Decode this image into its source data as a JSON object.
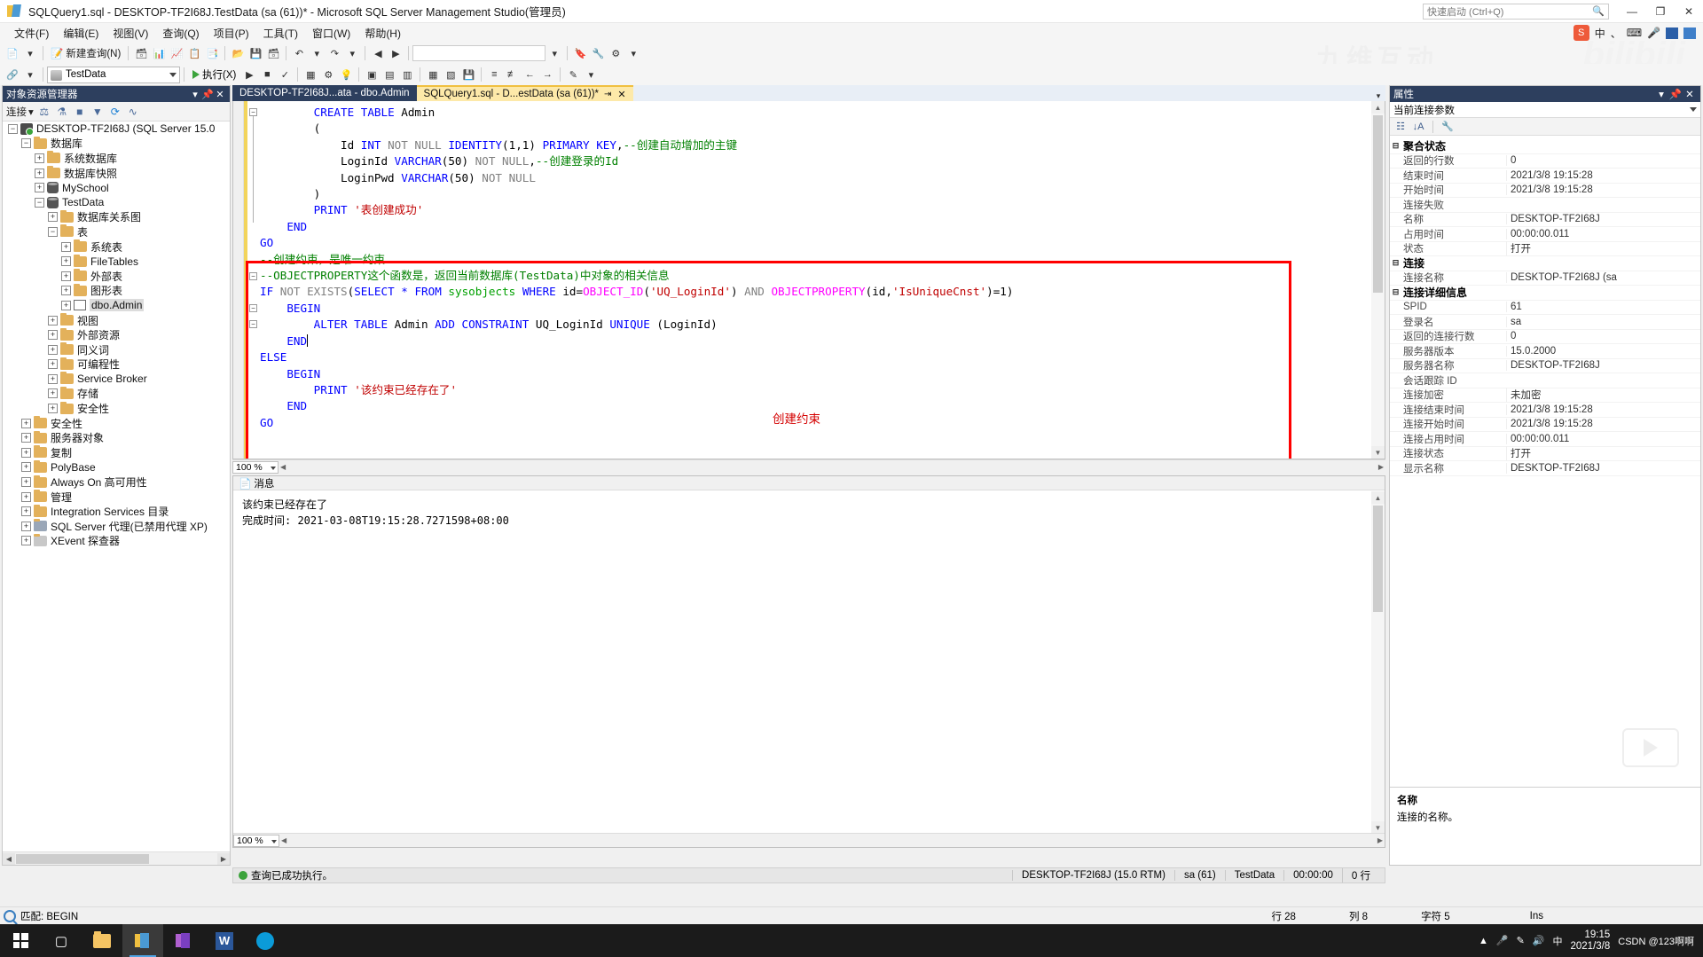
{
  "window": {
    "title": "SQLQuery1.sql - DESKTOP-TF2I68J.TestData (sa (61))* - Microsoft SQL Server Management Studio(管理员)",
    "quick_launch_placeholder": "快速启动 (Ctrl+Q)",
    "minimize": "—",
    "maximize": "❐",
    "close": "✕"
  },
  "menu": {
    "items": [
      "文件(F)",
      "编辑(E)",
      "视图(V)",
      "查询(Q)",
      "项目(P)",
      "工具(T)",
      "窗口(W)",
      "帮助(H)"
    ],
    "ime": {
      "badge": "S",
      "lang": "中",
      "dot": "、",
      "extra": "…"
    }
  },
  "toolbar1": {
    "new_query": "新建查询(N)",
    "database_label": "TestData",
    "items": [
      "文件",
      "打开",
      "保存",
      "全部保存",
      "撤消",
      "恢复"
    ]
  },
  "toolbar2": {
    "db_combo_value": "TestData",
    "execute": "执行(X)",
    "zoom": "100 %"
  },
  "object_explorer": {
    "title": "对象资源管理器",
    "connect_label": "连接",
    "tools": [
      "connect-icon",
      "disconnect-icon",
      "stop-icon",
      "filter-icon",
      "refresh-icon",
      "activity-icon"
    ],
    "tree": [
      {
        "indent": 0,
        "expander": "−",
        "icon": "server",
        "label": "DESKTOP-TF2I68J (SQL Server 15.0"
      },
      {
        "indent": 1,
        "expander": "−",
        "icon": "folder",
        "label": "数据库"
      },
      {
        "indent": 2,
        "expander": "+",
        "icon": "folder",
        "label": "系统数据库"
      },
      {
        "indent": 2,
        "expander": "+",
        "icon": "folder",
        "label": "数据库快照"
      },
      {
        "indent": 2,
        "expander": "+",
        "icon": "db",
        "label": "MySchool"
      },
      {
        "indent": 2,
        "expander": "−",
        "icon": "db",
        "label": "TestData"
      },
      {
        "indent": 3,
        "expander": "+",
        "icon": "folder",
        "label": "数据库关系图"
      },
      {
        "indent": 3,
        "expander": "−",
        "icon": "folder",
        "label": "表"
      },
      {
        "indent": 4,
        "expander": "+",
        "icon": "folder",
        "label": "系统表"
      },
      {
        "indent": 4,
        "expander": "+",
        "icon": "folder",
        "label": "FileTables"
      },
      {
        "indent": 4,
        "expander": "+",
        "icon": "folder",
        "label": "外部表"
      },
      {
        "indent": 4,
        "expander": "+",
        "icon": "folder",
        "label": "图形表"
      },
      {
        "indent": 4,
        "expander": "+",
        "icon": "table",
        "label": "dbo.Admin",
        "selected": true
      },
      {
        "indent": 3,
        "expander": "+",
        "icon": "folder",
        "label": "视图"
      },
      {
        "indent": 3,
        "expander": "+",
        "icon": "folder",
        "label": "外部资源"
      },
      {
        "indent": 3,
        "expander": "+",
        "icon": "folder",
        "label": "同义词"
      },
      {
        "indent": 3,
        "expander": "+",
        "icon": "folder",
        "label": "可编程性"
      },
      {
        "indent": 3,
        "expander": "+",
        "icon": "folder",
        "label": "Service Broker"
      },
      {
        "indent": 3,
        "expander": "+",
        "icon": "folder",
        "label": "存储"
      },
      {
        "indent": 3,
        "expander": "+",
        "icon": "folder",
        "label": "安全性"
      },
      {
        "indent": 1,
        "expander": "+",
        "icon": "folder",
        "label": "安全性"
      },
      {
        "indent": 1,
        "expander": "+",
        "icon": "folder",
        "label": "服务器对象"
      },
      {
        "indent": 1,
        "expander": "+",
        "icon": "folder",
        "label": "复制"
      },
      {
        "indent": 1,
        "expander": "+",
        "icon": "folder",
        "label": "PolyBase"
      },
      {
        "indent": 1,
        "expander": "+",
        "icon": "folder",
        "label": "Always On 高可用性"
      },
      {
        "indent": 1,
        "expander": "+",
        "icon": "folder",
        "label": "管理"
      },
      {
        "indent": 1,
        "expander": "+",
        "icon": "folder",
        "label": "Integration Services 目录"
      },
      {
        "indent": 1,
        "expander": "+",
        "icon": "agent",
        "label": "SQL Server 代理(已禁用代理 XP)"
      },
      {
        "indent": 1,
        "expander": "+",
        "icon": "xevent",
        "label": "XEvent 探查器"
      }
    ]
  },
  "editor": {
    "tabs": [
      {
        "label": "DESKTOP-TF2I68J...ata - dbo.Admin",
        "active": false
      },
      {
        "label": "SQLQuery1.sql - D...estData (sa (61))*",
        "active": true,
        "pin": "⇥",
        "close": "✕"
      }
    ],
    "annotation": "创建约束",
    "zoom": "100 %",
    "code_lines": [
      {
        "tokens": [
          {
            "t": "        ",
            "c": ""
          },
          {
            "t": "CREATE TABLE",
            "c": "kw"
          },
          {
            "t": " Admin",
            "c": ""
          }
        ]
      },
      {
        "tokens": [
          {
            "t": "        (",
            "c": ""
          }
        ]
      },
      {
        "tokens": [
          {
            "t": "            Id ",
            "c": ""
          },
          {
            "t": "INT",
            "c": "kw"
          },
          {
            "t": " ",
            "c": ""
          },
          {
            "t": "NOT NULL",
            "c": "kwg"
          },
          {
            "t": " ",
            "c": ""
          },
          {
            "t": "IDENTITY",
            "c": "kw"
          },
          {
            "t": "(",
            "c": ""
          },
          {
            "t": "1",
            "c": ""
          },
          {
            "t": ",",
            "c": ""
          },
          {
            "t": "1",
            "c": ""
          },
          {
            "t": ") ",
            "c": ""
          },
          {
            "t": "PRIMARY KEY",
            "c": "kw"
          },
          {
            "t": ",",
            "c": ""
          },
          {
            "t": "--创建自动增加的主键",
            "c": "cm"
          }
        ]
      },
      {
        "tokens": [
          {
            "t": "            LoginId ",
            "c": ""
          },
          {
            "t": "VARCHAR",
            "c": "kw"
          },
          {
            "t": "(",
            "c": ""
          },
          {
            "t": "50",
            "c": ""
          },
          {
            "t": ") ",
            "c": ""
          },
          {
            "t": "NOT NULL",
            "c": "kwg"
          },
          {
            "t": ",",
            "c": ""
          },
          {
            "t": "--创建登录的Id",
            "c": "cm"
          }
        ]
      },
      {
        "tokens": [
          {
            "t": "            LoginPwd ",
            "c": ""
          },
          {
            "t": "VARCHAR",
            "c": "kw"
          },
          {
            "t": "(",
            "c": ""
          },
          {
            "t": "50",
            "c": ""
          },
          {
            "t": ") ",
            "c": ""
          },
          {
            "t": "NOT NULL",
            "c": "kwg"
          }
        ]
      },
      {
        "tokens": [
          {
            "t": "        )",
            "c": ""
          }
        ]
      },
      {
        "tokens": [
          {
            "t": "        ",
            "c": ""
          },
          {
            "t": "PRINT",
            "c": "kw"
          },
          {
            "t": " ",
            "c": ""
          },
          {
            "t": "'表创建成功'",
            "c": "str"
          }
        ]
      },
      {
        "tokens": [
          {
            "t": "    ",
            "c": ""
          },
          {
            "t": "END",
            "c": "kw"
          }
        ]
      },
      {
        "tokens": [
          {
            "t": "",
            "c": ""
          },
          {
            "t": "GO",
            "c": "kw"
          }
        ]
      },
      {
        "tokens": [
          {
            "t": "",
            "c": ""
          }
        ]
      },
      {
        "tokens": [
          {
            "t": "--创建约束，是唯一约束",
            "c": "cm"
          }
        ]
      },
      {
        "tokens": [
          {
            "t": "--OBJECTPROPERTY这个函数是，返回当前数据库(TestData)中对象的相关信息",
            "c": "cm"
          }
        ]
      },
      {
        "tokens": [
          {
            "t": "IF",
            "c": "kw"
          },
          {
            "t": " ",
            "c": ""
          },
          {
            "t": "NOT EXISTS",
            "c": "kwg"
          },
          {
            "t": "(",
            "c": ""
          },
          {
            "t": "SELECT",
            "c": "kw"
          },
          {
            "t": " ",
            "c": ""
          },
          {
            "t": "*",
            "c": "kw"
          },
          {
            "t": " ",
            "c": ""
          },
          {
            "t": "FROM",
            "c": "kw"
          },
          {
            "t": " ",
            "c": ""
          },
          {
            "t": "sysobjects",
            "c": "tbl"
          },
          {
            "t": " ",
            "c": ""
          },
          {
            "t": "WHERE",
            "c": "kw"
          },
          {
            "t": " id=",
            "c": ""
          },
          {
            "t": "OBJECT_ID",
            "c": "fn"
          },
          {
            "t": "(",
            "c": ""
          },
          {
            "t": "'UQ_LoginId'",
            "c": "str"
          },
          {
            "t": ") ",
            "c": ""
          },
          {
            "t": "AND",
            "c": "kwg"
          },
          {
            "t": " ",
            "c": ""
          },
          {
            "t": "OBJECTPROPERTY",
            "c": "fn"
          },
          {
            "t": "(id,",
            "c": ""
          },
          {
            "t": "'IsUniqueCnst'",
            "c": "str"
          },
          {
            "t": ")=",
            "c": ""
          },
          {
            "t": "1",
            "c": ""
          },
          {
            "t": ")",
            "c": ""
          }
        ]
      },
      {
        "tokens": [
          {
            "t": "    ",
            "c": ""
          },
          {
            "t": "BEGIN",
            "c": "kw"
          }
        ]
      },
      {
        "tokens": [
          {
            "t": "        ",
            "c": ""
          },
          {
            "t": "ALTER TABLE",
            "c": "kw"
          },
          {
            "t": " Admin ",
            "c": ""
          },
          {
            "t": "ADD",
            "c": "kw"
          },
          {
            "t": " ",
            "c": ""
          },
          {
            "t": "CONSTRAINT",
            "c": "kw"
          },
          {
            "t": " UQ_LoginId ",
            "c": ""
          },
          {
            "t": "UNIQUE",
            "c": "kw"
          },
          {
            "t": " (LoginId)",
            "c": ""
          }
        ]
      },
      {
        "tokens": [
          {
            "t": "    ",
            "c": ""
          },
          {
            "t": "END",
            "c": "kw"
          },
          {
            "t": "|",
            "c": "caret"
          }
        ]
      },
      {
        "tokens": [
          {
            "t": "ELSE",
            "c": "kw"
          }
        ]
      },
      {
        "tokens": [
          {
            "t": "    ",
            "c": ""
          },
          {
            "t": "BEGIN",
            "c": "kw"
          }
        ]
      },
      {
        "tokens": [
          {
            "t": "        ",
            "c": ""
          },
          {
            "t": "PRINT",
            "c": "kw"
          },
          {
            "t": " ",
            "c": ""
          },
          {
            "t": "'该约束已经存在了'",
            "c": "str"
          }
        ]
      },
      {
        "tokens": [
          {
            "t": "    ",
            "c": ""
          },
          {
            "t": "END",
            "c": "kw"
          }
        ]
      },
      {
        "tokens": [
          {
            "t": "",
            "c": ""
          },
          {
            "t": "GO",
            "c": "kw"
          }
        ]
      }
    ]
  },
  "messages": {
    "tab_label": "消息",
    "lines": [
      "该约束已经存在了",
      "",
      "完成时间: 2021-03-08T19:15:28.7271598+08:00"
    ],
    "zoom": "100 %"
  },
  "status_bar": {
    "state": "查询已成功执行。",
    "server": "DESKTOP-TF2I68J (15.0 RTM)",
    "user": "sa (61)",
    "database": "TestData",
    "elapsed": "00:00:00",
    "rows": "0 行"
  },
  "properties": {
    "title": "属性",
    "selected_object": "当前连接参数",
    "groups": [
      {
        "name": "聚合状态",
        "rows": [
          {
            "name": "返回的行数",
            "value": "0"
          },
          {
            "name": "结束时间",
            "value": "2021/3/8 19:15:28"
          },
          {
            "name": "开始时间",
            "value": "2021/3/8 19:15:28"
          },
          {
            "name": "连接失败",
            "value": ""
          },
          {
            "name": "名称",
            "value": "DESKTOP-TF2I68J"
          },
          {
            "name": "占用时间",
            "value": "00:00:00.011"
          },
          {
            "name": "状态",
            "value": "打开"
          }
        ]
      },
      {
        "name": "连接",
        "rows": [
          {
            "name": "连接名称",
            "value": "DESKTOP-TF2I68J (sa"
          }
        ]
      },
      {
        "name": "连接详细信息",
        "rows": [
          {
            "name": "SPID",
            "value": "61"
          },
          {
            "name": "登录名",
            "value": "sa"
          },
          {
            "name": "返回的连接行数",
            "value": "0"
          },
          {
            "name": "服务器版本",
            "value": "15.0.2000"
          },
          {
            "name": "服务器名称",
            "value": "DESKTOP-TF2I68J"
          },
          {
            "name": "会话跟踪 ID",
            "value": ""
          },
          {
            "name": "连接加密",
            "value": "未加密"
          },
          {
            "name": "连接结束时间",
            "value": "2021/3/8 19:15:28"
          },
          {
            "name": "连接开始时间",
            "value": "2021/3/8 19:15:28"
          },
          {
            "name": "连接占用时间",
            "value": "00:00:00.011"
          },
          {
            "name": "连接状态",
            "value": "打开"
          },
          {
            "name": "显示名称",
            "value": "DESKTOP-TF2I68J"
          }
        ]
      }
    ],
    "description_title": "名称",
    "description_text": "连接的名称。"
  },
  "find_bar": {
    "text": "匹配: BEGIN"
  },
  "bottom_status": {
    "line_label": "行 28",
    "col_label": "列 8",
    "char_label": "字符 5",
    "ins_label": "Ins"
  },
  "taskbar": {
    "time": "19:15",
    "date": "2021/3/8",
    "tray": [
      "^",
      "mic-icon",
      "pen-icon",
      "volume-icon",
      "中",
      "csdn-icon"
    ],
    "csdn": "CSDN @123啊啊"
  },
  "colors": {
    "accent": "#2d3f5e",
    "tab_active": "#fde9a9",
    "redbox": "#ff0000",
    "annotation": "#d40000",
    "keyword": "#0000ff",
    "comment": "#008000",
    "string": "#c00000",
    "function": "#ff00ff"
  }
}
